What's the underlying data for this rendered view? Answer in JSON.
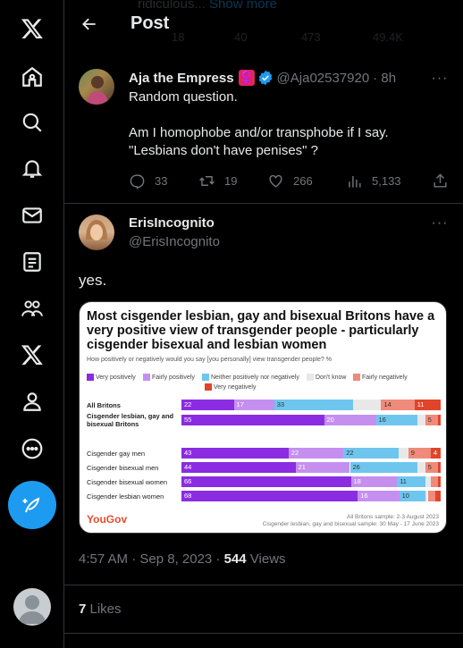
{
  "header": {
    "title": "Post",
    "ghost_text": "ridiculous...",
    "ghost_link": "Show more",
    "ghost_counts": [
      "18",
      "40",
      "473",
      "49.4K"
    ]
  },
  "tweet1": {
    "name": "Aja the Empress",
    "emoji": "♀️",
    "handle": "@Aja02537920",
    "time": "· 8h",
    "text": "Random question.\n\nAm I homophobe and/or transphobe if I say. \"Lesbians don't have penises\" ?",
    "replies": "33",
    "retweets": "19",
    "likes": "266",
    "views": "5,133"
  },
  "tweet2": {
    "name": "ErisIncognito",
    "handle": "@ErisIncognito",
    "text": "yes.",
    "timestamp": "4:57 AM · Sep 8, 2023 · ",
    "views_count": "544",
    "views_label": " Views",
    "likes_count": "7",
    "likes_label": " Likes"
  },
  "chart_data": {
    "type": "bar",
    "title": "Most cisgender lesbian, gay and bisexual Britons have a very positive view of transgender people - particularly cisgender bisexual and lesbian women",
    "question": "How positively or negatively would you say [you personally] view transgender people? %",
    "legend": [
      "Very positively",
      "Fairly positively",
      "Neither positively nor negatively",
      "Don't know",
      "Fairly negatively",
      "Very negatively"
    ],
    "colors": [
      "#8b2be2",
      "#c58ff0",
      "#6ec6ef",
      "#e8e8e8",
      "#f08a7a",
      "#e2442a"
    ],
    "categories": [
      "All Britons",
      "Cisgender lesbian, gay and bisexual Britons",
      "Cisgender gay men",
      "Cisgender bisexual men",
      "Cisgender bisexual women",
      "Cisgender lesbian women"
    ],
    "series": [
      {
        "name": "Very positively",
        "values": [
          22,
          55,
          43,
          44,
          66,
          68
        ]
      },
      {
        "name": "Fairly positively",
        "values": [
          17,
          20,
          22,
          21,
          18,
          16
        ]
      },
      {
        "name": "Neither positively nor negatively",
        "values": [
          33,
          16,
          22,
          26,
          11,
          10
        ]
      },
      {
        "name": "Don't know",
        "values": [
          12,
          3,
          4,
          3,
          2,
          1
        ]
      },
      {
        "name": "Fairly negatively",
        "values": [
          14,
          5,
          9,
          5,
          3,
          3
        ]
      },
      {
        "name": "Very negatively",
        "values": [
          11,
          1,
          4,
          1,
          1,
          2
        ]
      }
    ],
    "brand": "YouGov",
    "source_line1": "All Britons sample: 2-3 August 2023",
    "source_line2": "Cisgender lesbian, gay and bisexual sample: 30 May - 17 June 2023"
  }
}
